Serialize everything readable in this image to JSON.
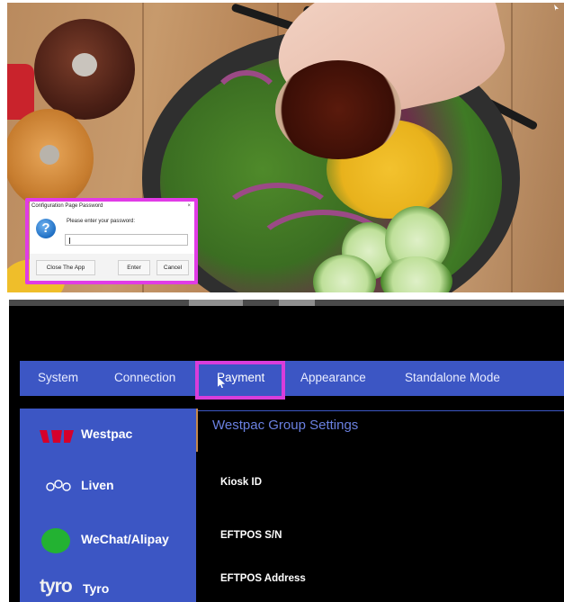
{
  "dialog": {
    "title": "Configuration Page Password",
    "close_glyph": "×",
    "icon": "question-icon",
    "prompt": "Please enter your password:",
    "password_value": "",
    "buttons": {
      "close_app": "Close The App",
      "enter": "Enter",
      "cancel": "Cancel"
    },
    "highlight_color": "#e13be6"
  },
  "app": {
    "tabs": [
      {
        "label": "System"
      },
      {
        "label": "Connection"
      },
      {
        "label": "Payment",
        "active": true
      },
      {
        "label": "Appearance"
      },
      {
        "label": "Standalone Mode"
      }
    ],
    "sidebar": [
      {
        "label": "Westpac",
        "icon": "westpac-logo-icon"
      },
      {
        "label": "Liven",
        "icon": "liven-logo-icon"
      },
      {
        "label": "WeChat/Alipay",
        "icon": "wechat-logo-icon"
      },
      {
        "label": "Tyro",
        "logo_text": "tyro",
        "icon": "tyro-logo-icon"
      }
    ],
    "content": {
      "title": "Westpac Group Settings",
      "fields": [
        "Kiosk ID",
        "EFTPOS S/N",
        "EFTPOS Address"
      ]
    },
    "colors": {
      "nav_blue": "#3c56c4",
      "title_blue": "#6a80e0",
      "highlight": "#d93ddb",
      "westpac_red": "#d5002b",
      "wechat_green": "#23b232"
    }
  }
}
